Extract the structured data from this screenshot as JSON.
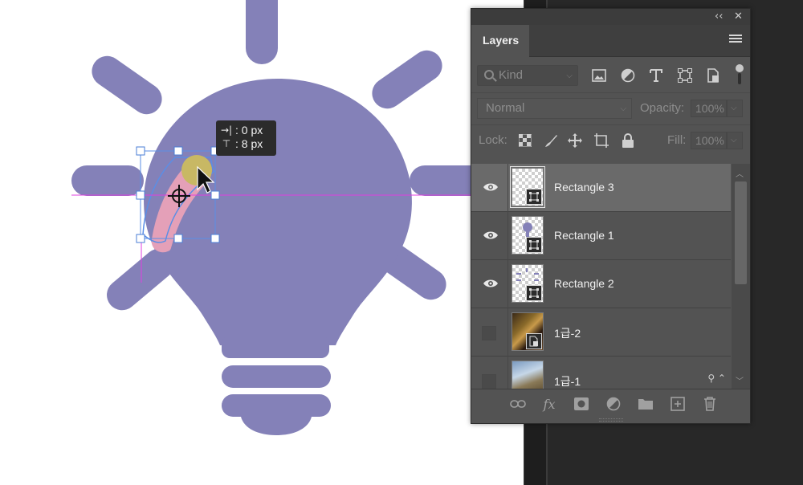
{
  "canvas": {
    "bulb_color": "#8481b8",
    "selection_color": "#e4a0b8",
    "handle_color": "#5a8ee6",
    "guide_color": "#e040e0",
    "cursor_blob_color": "#c8b864"
  },
  "tooltip": {
    "h_symbol": "→|",
    "h_value": ": 0 px",
    "v_symbol": "⊤",
    "v_value": ": 8 px"
  },
  "panel": {
    "collapse_glyph": "‹‹",
    "close_glyph": "✕",
    "tab_label": "Layers",
    "filter": {
      "kind_placeholder": "Kind",
      "icons": [
        "image-filter-icon",
        "adjustment-filter-icon",
        "type-filter-icon",
        "shape-filter-icon",
        "smart-object-filter-icon"
      ]
    },
    "blend": {
      "mode": "Normal",
      "opacity_label": "Opacity:",
      "opacity_value": "100%"
    },
    "lock": {
      "label": "Lock:",
      "fill_label": "Fill:",
      "fill_value": "100%"
    },
    "layers": [
      {
        "name": "Rectangle 3",
        "visible": true,
        "selected": true,
        "thumb": "transparent"
      },
      {
        "name": "Rectangle 1",
        "visible": true,
        "selected": false,
        "thumb": "bulb"
      },
      {
        "name": "Rectangle 2",
        "visible": true,
        "selected": false,
        "thumb": "rays"
      },
      {
        "name": "1급-2",
        "visible": false,
        "selected": false,
        "thumb": "photo1"
      },
      {
        "name": "1급-1",
        "visible": false,
        "selected": false,
        "thumb": "photo2"
      }
    ],
    "footer": [
      "link-layers-icon",
      "fx-icon",
      "add-mask-icon",
      "adjustment-layer-icon",
      "group-folder-icon",
      "new-layer-icon",
      "delete-layer-icon"
    ]
  }
}
